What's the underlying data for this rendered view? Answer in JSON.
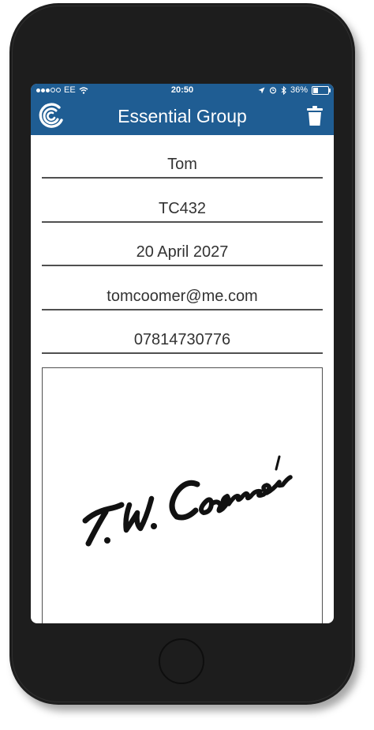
{
  "status_bar": {
    "carrier": "EE",
    "time": "20:50",
    "battery": "36%",
    "battery_level": 0.36
  },
  "header": {
    "title": "Essential Group",
    "logo_icon": "swirl-logo-icon",
    "delete_icon": "trash-icon",
    "background_color": "#1f5d93"
  },
  "form": {
    "name": "Tom",
    "code": "TC432",
    "date": "20 April 2027",
    "email": "tomcoomer@me.com",
    "phone": "07814730776",
    "signature": "T.W. Coomer"
  }
}
